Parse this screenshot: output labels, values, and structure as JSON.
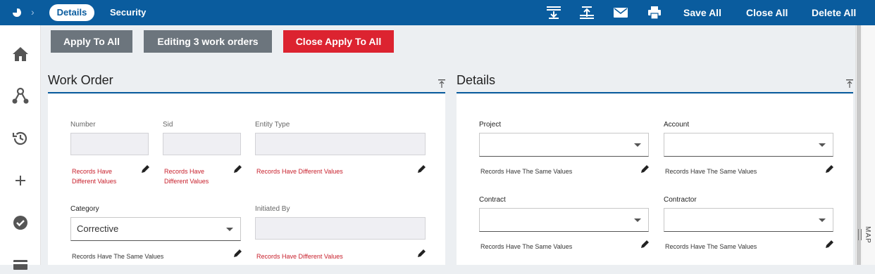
{
  "topbar": {
    "tabs": [
      {
        "label": "Details"
      },
      {
        "label": "Security"
      }
    ],
    "icons": [
      "expand-all-icon",
      "collapse-all-icon",
      "email-icon",
      "print-icon"
    ],
    "actions": {
      "save_all": "Save All",
      "close_all": "Close All",
      "delete_all": "Delete All"
    }
  },
  "left_nav": [
    "home-icon",
    "hierarchy-icon",
    "history-icon",
    "plus-icon",
    "check-circle-icon",
    "card-icon"
  ],
  "apply_buttons": {
    "apply_to_all": "Apply To All",
    "editing": "Editing 3 work orders",
    "close_apply": "Close Apply To All"
  },
  "work_order": {
    "title": "Work Order",
    "fields": {
      "number": {
        "label": "Number",
        "value": "",
        "message": "Records Have Different Values"
      },
      "sid": {
        "label": "Sid",
        "value": "",
        "message": "Records Have Different Values"
      },
      "entity_type": {
        "label": "Entity Type",
        "value": "",
        "message": "Records Have Different Values"
      },
      "category": {
        "label": "Category",
        "value": "Corrective",
        "message": "Records Have The Same Values"
      },
      "initiated_by": {
        "label": "Initiated By",
        "value": "",
        "message": "Records Have Different Values"
      }
    }
  },
  "details": {
    "title": "Details",
    "fields": {
      "project": {
        "label": "Project",
        "value": "",
        "message": "Records Have The Same Values"
      },
      "account": {
        "label": "Account",
        "value": "",
        "message": "Records Have The Same Values"
      },
      "contract": {
        "label": "Contract",
        "value": "",
        "message": "Records Have The Same Values"
      },
      "contractor": {
        "label": "Contractor",
        "value": "",
        "message": "Records Have The Same Values"
      }
    }
  },
  "map_panel": {
    "label": "MAP"
  },
  "colors": {
    "brand": "#0a5c9e",
    "danger": "#dc2330",
    "neutral": "#6c757d"
  }
}
